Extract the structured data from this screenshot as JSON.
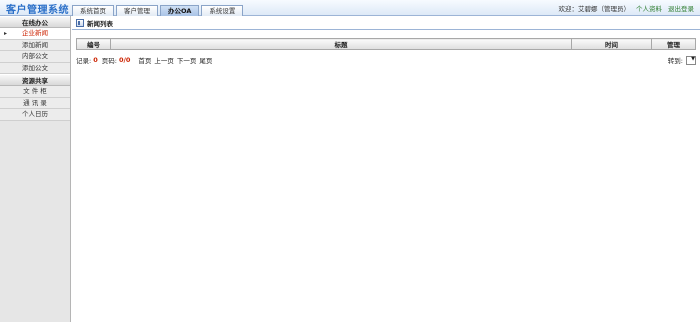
{
  "app": {
    "title": "客户管理系统"
  },
  "tabs": [
    {
      "label": "系统首页"
    },
    {
      "label": "客户管理"
    },
    {
      "label": "办公OA"
    },
    {
      "label": "系统设置"
    }
  ],
  "user": {
    "welcome": "欢迎：艾碧娜（管理员）",
    "profile_link": "个人资料",
    "logout_link": "退出登录"
  },
  "sidebar": {
    "groups": [
      {
        "title": "在线办公",
        "items": [
          "企业新闻",
          "添加新闻",
          "内部公文",
          "添加公文"
        ]
      },
      {
        "title": "资源共享",
        "items": [
          "文 件 柜",
          "通 讯 录",
          "个人日历"
        ]
      }
    ]
  },
  "panel": {
    "title": "新闻列表"
  },
  "table": {
    "columns": [
      "编号",
      "标题",
      "时间",
      "管理"
    ]
  },
  "pager": {
    "records_label": "记录:",
    "records_value": "0",
    "pages_label": "页码:",
    "pages_value": "0/0",
    "first": "首页",
    "prev": "上一页",
    "next": "下一页",
    "last": "尾页",
    "goto_label": "转到:"
  }
}
